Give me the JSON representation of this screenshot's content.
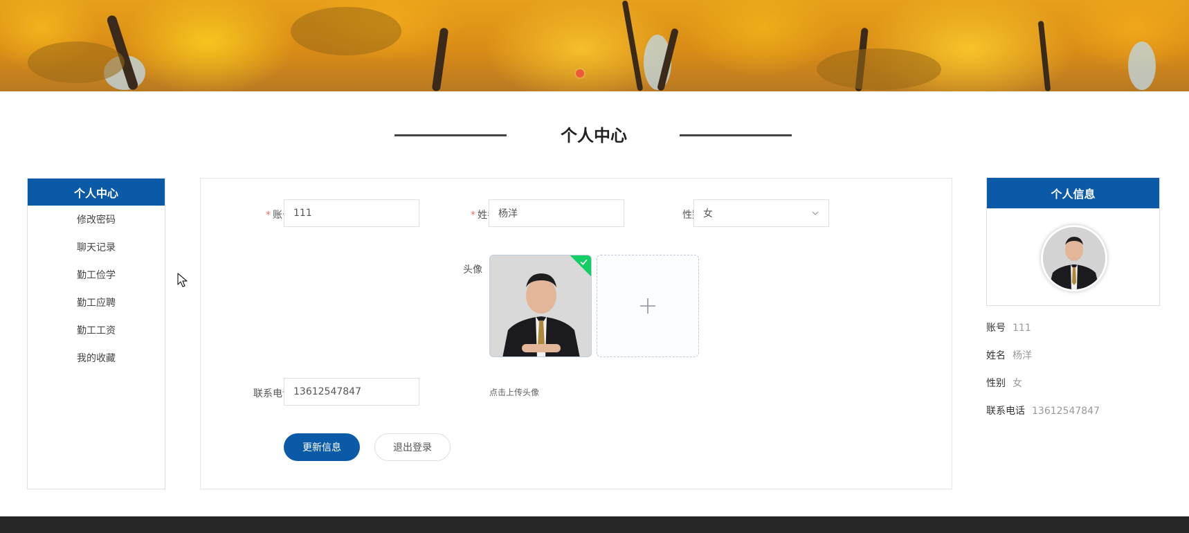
{
  "page": {
    "title": "个人中心"
  },
  "sidebar": {
    "header": "个人中心",
    "items": [
      {
        "label": "修改密码"
      },
      {
        "label": "聊天记录"
      },
      {
        "label": "勤工俭学"
      },
      {
        "label": "勤工应聘"
      },
      {
        "label": "勤工工资"
      },
      {
        "label": "我的收藏"
      }
    ]
  },
  "form": {
    "required_mark": "*",
    "account": {
      "label": "账号",
      "value": "111"
    },
    "name": {
      "label": "姓名",
      "value": "杨洋"
    },
    "gender": {
      "label": "性别",
      "value": "女"
    },
    "avatar": {
      "label": "头像",
      "upload_hint": "点击上传头像"
    },
    "phone": {
      "label": "联系电话",
      "value": "13612547847"
    },
    "update_button": "更新信息",
    "logout_button": "退出登录"
  },
  "info_card": {
    "header": "个人信息",
    "rows": [
      {
        "key": "账号",
        "value": "111"
      },
      {
        "key": "姓名",
        "value": "杨洋"
      },
      {
        "key": "性别",
        "value": "女"
      },
      {
        "key": "联系电话",
        "value": "13612547847"
      }
    ]
  },
  "colors": {
    "brand": "#0a5aa8",
    "success": "#13ce66",
    "required": "#f56c6c",
    "footer": "#262626"
  }
}
